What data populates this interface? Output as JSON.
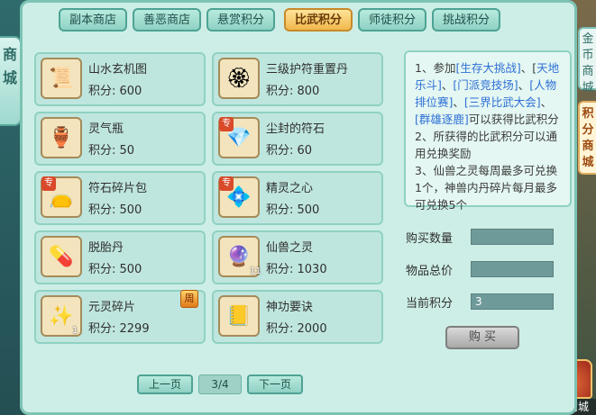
{
  "left_tab": {
    "label": "商城"
  },
  "right_tabs": {
    "tab1": "金币商城",
    "tab2": "积分商城"
  },
  "palace": {
    "label": "外观商城"
  },
  "tabs": [
    {
      "label": "副本商店",
      "active": false
    },
    {
      "label": "善恶商店",
      "active": false
    },
    {
      "label": "悬赏积分",
      "active": false
    },
    {
      "label": "比武积分",
      "active": true
    },
    {
      "label": "师徒积分",
      "active": false
    },
    {
      "label": "挑战积分",
      "active": false
    }
  ],
  "items": [
    {
      "name": "山水玄机图",
      "price": "积分: 600",
      "icon": "scroll-icon"
    },
    {
      "name": "三级护符重置丹",
      "price": "积分: 800",
      "icon": "talisman-icon"
    },
    {
      "name": "灵气瓶",
      "price": "积分: 50",
      "icon": "vase-icon"
    },
    {
      "name": "尘封的符石",
      "price": "积分: 60",
      "icon": "gem-icon",
      "mark": "专"
    },
    {
      "name": "符石碎片包",
      "price": "积分: 500",
      "icon": "bag-icon",
      "mark": "专"
    },
    {
      "name": "精灵之心",
      "price": "积分: 500",
      "icon": "heart-icon",
      "mark": "专"
    },
    {
      "name": "脱胎丹",
      "price": "积分: 500",
      "icon": "pill-icon"
    },
    {
      "name": "仙兽之灵",
      "price": "积分: 1030",
      "icon": "orb-icon",
      "count": "11"
    },
    {
      "name": "元灵碎片",
      "price": "积分: 2299",
      "icon": "shard-icon",
      "count": "1",
      "weekly": "周"
    },
    {
      "name": "神功要诀",
      "price": "积分: 2000",
      "icon": "book-icon"
    }
  ],
  "info": {
    "lines": [
      "1、参加",
      "[生存大挑战]",
      "、[",
      "天地乐斗]",
      "、",
      "[门派竞技场]",
      "、",
      "[人物排位赛]",
      "、",
      "[三界比武大会]",
      "、",
      "[群雄逐鹿]",
      "可以获得比武积分",
      "2、所获得的比武积分可以通用兑换奖励",
      "3、仙兽之灵每周最多可兑换1个，神兽内丹碎片每月最多可兑换5个"
    ]
  },
  "form": {
    "qty_label": "购买数量",
    "total_label": "物品总价",
    "current_label": "当前积分",
    "current_value": "3",
    "buy_label": "购 买"
  },
  "pager": {
    "prev": "上一页",
    "page": "3/4",
    "next": "下一页"
  },
  "colors": {
    "accent": "#f0b84c",
    "panel": "#cdeee6",
    "link": "#2e6fd6"
  }
}
